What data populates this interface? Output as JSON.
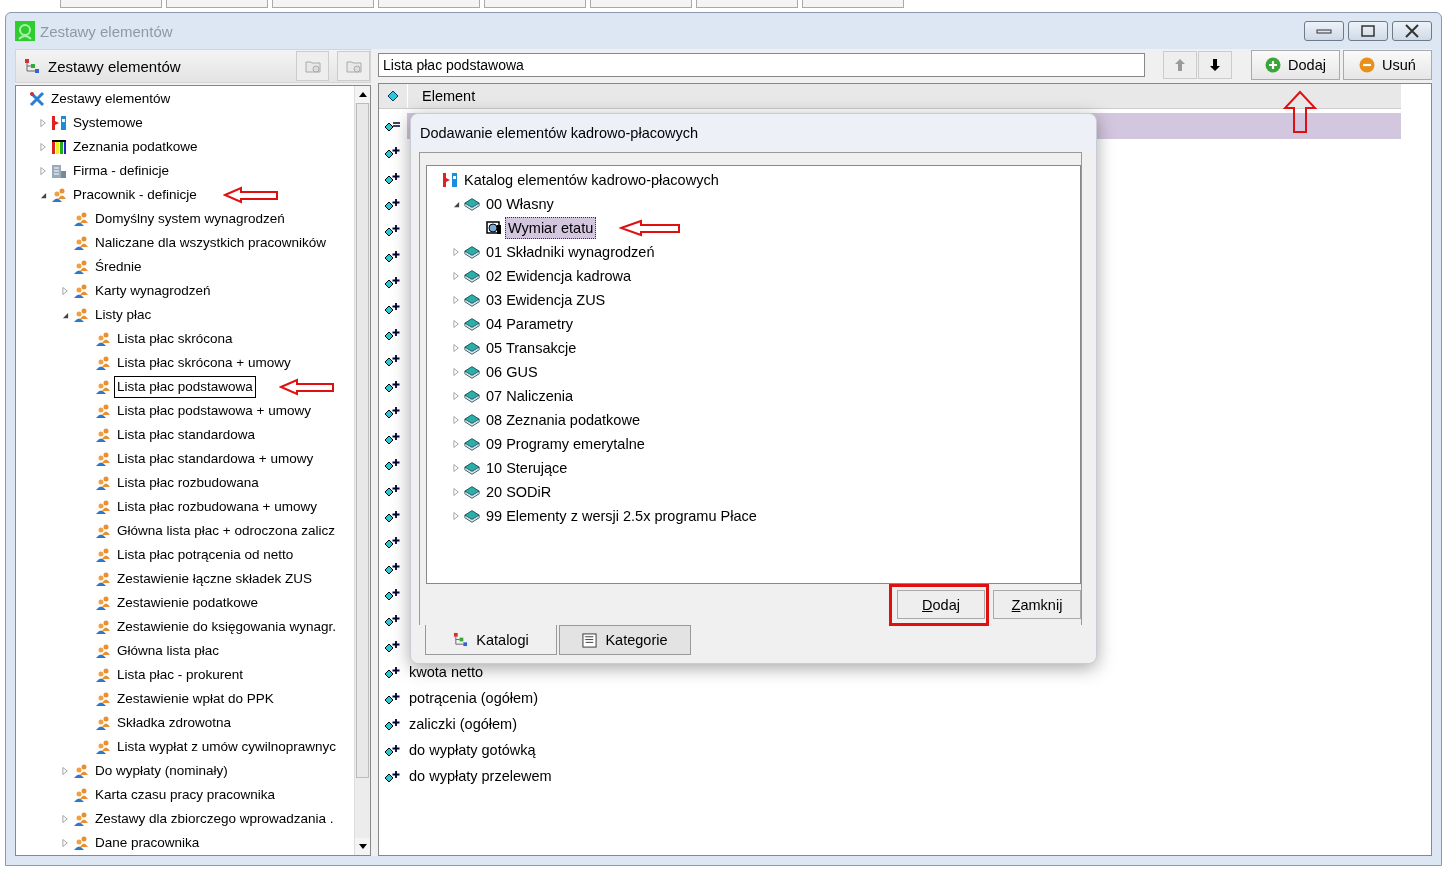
{
  "window": {
    "title": "Zestawy elementów"
  },
  "left_panel": {
    "title": "Zestawy elementów",
    "tree": [
      {
        "label": "Zestawy elementów",
        "kind": "tools",
        "selected": false,
        "children": [
          {
            "label": "Systemowe",
            "kind": "system",
            "expanded": false,
            "selected": false
          },
          {
            "label": "Zeznania podatkowe",
            "kind": "tax",
            "expanded": false,
            "selected": false
          },
          {
            "label": "Firma - definicje",
            "kind": "company",
            "expanded": false,
            "selected": false
          },
          {
            "label": "Pracownik - definicje",
            "kind": "people",
            "expanded": true,
            "selected": false,
            "annotated": true,
            "children": [
              {
                "label": "Domyślny system wynagrodzeń",
                "kind": "people",
                "selected": false
              },
              {
                "label": "Naliczane dla wszystkich pracowników",
                "kind": "people",
                "selected": false
              },
              {
                "label": "Średnie",
                "kind": "people",
                "selected": false
              },
              {
                "label": "Karty wynagrodzeń",
                "kind": "people",
                "expanded": false,
                "selected": false
              },
              {
                "label": "Listy płac",
                "kind": "people",
                "expanded": true,
                "selected": false,
                "children": [
                  {
                    "label": "Lista płac skrócona",
                    "kind": "people",
                    "selected": false
                  },
                  {
                    "label": "Lista płac skrócona + umowy",
                    "kind": "people",
                    "selected": false
                  },
                  {
                    "label": "Lista płac podstawowa",
                    "kind": "people",
                    "selected": true,
                    "annotated": true
                  },
                  {
                    "label": "Lista płac podstawowa + umowy",
                    "kind": "people",
                    "selected": false
                  },
                  {
                    "label": "Lista płac standardowa",
                    "kind": "people",
                    "selected": false
                  },
                  {
                    "label": "Lista płac standardowa + umowy",
                    "kind": "people",
                    "selected": false
                  },
                  {
                    "label": "Lista płac rozbudowana",
                    "kind": "people",
                    "selected": false
                  },
                  {
                    "label": "Lista płac rozbudowana + umowy",
                    "kind": "people",
                    "selected": false
                  },
                  {
                    "label": "Główna lista płac + odroczona zalicz",
                    "kind": "people",
                    "selected": false
                  },
                  {
                    "label": "Lista płac potrącenia od netto",
                    "kind": "people",
                    "selected": false
                  },
                  {
                    "label": "Zestawienie łączne składek ZUS",
                    "kind": "people",
                    "selected": false
                  },
                  {
                    "label": "Zestawienie podatkowe",
                    "kind": "people",
                    "selected": false
                  },
                  {
                    "label": "Zestawienie do księgowania wynagr.",
                    "kind": "people",
                    "selected": false
                  },
                  {
                    "label": "Główna lista płac",
                    "kind": "people",
                    "selected": false
                  },
                  {
                    "label": "Lista płac - prokurent",
                    "kind": "people",
                    "selected": false
                  },
                  {
                    "label": "Zestawienie wpłat do PPK",
                    "kind": "people",
                    "selected": false
                  },
                  {
                    "label": "Składka zdrowotna",
                    "kind": "people",
                    "selected": false
                  },
                  {
                    "label": "Lista wypłat z umów cywilnoprawnyc",
                    "kind": "people",
                    "selected": false
                  }
                ]
              },
              {
                "label": "Do wypłaty (nominały)",
                "kind": "people",
                "expanded": false,
                "selected": false
              },
              {
                "label": "Karta czasu pracy pracownika",
                "kind": "people",
                "selected": false
              },
              {
                "label": "Zestawy dla zbiorczego wprowadzania .",
                "kind": "people",
                "expanded": false,
                "selected": false
              },
              {
                "label": "Dane pracownika",
                "kind": "people",
                "expanded": false,
                "selected": false
              }
            ]
          }
        ]
      }
    ]
  },
  "toolbar": {
    "name_field": {
      "value": "Lista płac podstawowa"
    },
    "move_up": {
      "disabled": true
    },
    "move_down": {
      "disabled": false
    },
    "buttons": [
      {
        "label": "Dodaj",
        "kind": "add",
        "annotated": true
      },
      {
        "label": "Usuń",
        "kind": "remove",
        "annotated": false
      }
    ]
  },
  "grid": {
    "columns": [
      "Element"
    ],
    "rows": [
      {
        "kind": "list",
        "selected": true
      },
      {
        "kind": "item",
        "selected": false
      },
      {
        "kind": "item",
        "selected": false
      },
      {
        "kind": "item",
        "selected": false
      },
      {
        "kind": "item",
        "selected": false
      },
      {
        "kind": "item",
        "selected": false
      },
      {
        "kind": "item",
        "selected": false
      },
      {
        "kind": "item",
        "selected": false
      },
      {
        "kind": "item",
        "selected": false
      },
      {
        "kind": "item",
        "selected": false
      },
      {
        "kind": "item",
        "selected": false
      },
      {
        "kind": "item",
        "selected": false
      },
      {
        "kind": "item",
        "selected": false
      },
      {
        "kind": "item",
        "selected": false
      },
      {
        "kind": "item",
        "selected": false
      },
      {
        "kind": "item",
        "selected": false
      },
      {
        "kind": "item",
        "selected": false
      },
      {
        "kind": "item",
        "selected": false
      },
      {
        "kind": "item",
        "selected": false
      },
      {
        "kind": "item",
        "selected": false
      },
      {
        "kind": "item",
        "selected": false
      },
      {
        "kind": "item",
        "selected": false,
        "text": "kwota netto"
      },
      {
        "kind": "item",
        "selected": false,
        "text": "potrącenia (ogółem)"
      },
      {
        "kind": "item",
        "selected": false,
        "text": "zaliczki (ogółem)"
      },
      {
        "kind": "item",
        "selected": false,
        "text": "do wypłaty gotówką"
      },
      {
        "kind": "item",
        "selected": false,
        "text": "do wypłaty przelewem"
      }
    ]
  },
  "dialog": {
    "title": "Dodawanie elementów kadrowo-płacowych",
    "tree": [
      {
        "label": "Katalog elementów kadrowo-płacowych",
        "kind": "system",
        "selected": false,
        "children": [
          {
            "label": "00 Własny",
            "kind": "book",
            "expanded": true,
            "selected": false,
            "children": [
              {
                "label": "Wymiar etatu",
                "kind": "element",
                "selected": true,
                "annotated": true
              }
            ]
          },
          {
            "label": "01 Składniki wynagrodzeń",
            "kind": "book",
            "expanded": false,
            "selected": false
          },
          {
            "label": "02 Ewidencja kadrowa",
            "kind": "book",
            "expanded": false,
            "selected": false
          },
          {
            "label": "03 Ewidencja ZUS",
            "kind": "book",
            "expanded": false,
            "selected": false
          },
          {
            "label": "04 Parametry",
            "kind": "book",
            "expanded": false,
            "selected": false
          },
          {
            "label": "05 Transakcje",
            "kind": "book",
            "expanded": false,
            "selected": false
          },
          {
            "label": "06 GUS",
            "kind": "book",
            "expanded": false,
            "selected": false
          },
          {
            "label": "07 Naliczenia",
            "kind": "book",
            "expanded": false,
            "selected": false
          },
          {
            "label": "08 Zeznania podatkowe",
            "kind": "book",
            "expanded": false,
            "selected": false
          },
          {
            "label": "09 Programy emerytalne",
            "kind": "book",
            "expanded": false,
            "selected": false
          },
          {
            "label": "10 Sterujące",
            "kind": "book",
            "expanded": false,
            "selected": false
          },
          {
            "label": "20 SODiR",
            "kind": "book",
            "expanded": false,
            "selected": false
          },
          {
            "label": "99 Elementy z wersji 2.5x programu Płace",
            "kind": "book",
            "expanded": false,
            "selected": false
          }
        ]
      }
    ],
    "buttons": [
      {
        "label": "Dodaj",
        "annotated": true
      },
      {
        "label": "Zamknij",
        "annotated": false
      }
    ],
    "tabs": [
      {
        "label": "Katalogi",
        "kind": "tree",
        "selected": true
      },
      {
        "label": "Kategorie",
        "kind": "list",
        "selected": false
      }
    ]
  }
}
